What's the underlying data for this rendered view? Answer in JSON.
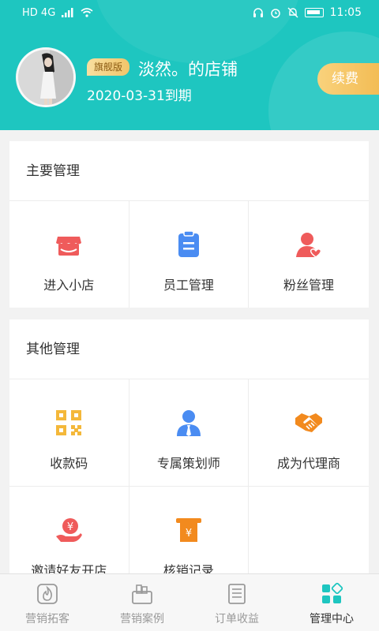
{
  "status_bar": {
    "left_text": "HD 4G",
    "time": "11:05",
    "icons": [
      "signal-icon",
      "wifi-icon",
      "headset-icon",
      "alarm-icon",
      "mute-icon",
      "battery-icon"
    ]
  },
  "header": {
    "badge": "旗舰版",
    "shop_name": "淡然。的店铺",
    "expire": "2020-03-31到期",
    "renew_label": "续费",
    "bg_color": "#1ec6c0"
  },
  "main_section": {
    "title": "主要管理",
    "items": [
      {
        "label": "进入小店",
        "icon": "shop-icon",
        "color": "#ef5b5b"
      },
      {
        "label": "员工管理",
        "icon": "clipboard-icon",
        "color": "#4a8cf2"
      },
      {
        "label": "粉丝管理",
        "icon": "fans-icon",
        "color": "#ef5b5b"
      }
    ]
  },
  "other_section": {
    "title": "其他管理",
    "items": [
      {
        "label": "收款码",
        "icon": "qr-code-icon",
        "color": "#f4b83a"
      },
      {
        "label": "专属策划师",
        "icon": "planner-icon",
        "color": "#4a8cf2"
      },
      {
        "label": "成为代理商",
        "icon": "handshake-icon",
        "color": "#f28a1e"
      },
      {
        "label": "邀请好友开店",
        "icon": "invite-money-icon",
        "color": "#ef5b5b"
      },
      {
        "label": "核销记录",
        "icon": "receipt-icon",
        "color": "#f28a1e"
      }
    ]
  },
  "tabbar": {
    "items": [
      {
        "label": "营销拓客",
        "icon": "flame-icon",
        "active": false
      },
      {
        "label": "营销案例",
        "icon": "cases-icon",
        "active": false
      },
      {
        "label": "订单收益",
        "icon": "orders-icon",
        "active": false
      },
      {
        "label": "管理中心",
        "icon": "management-icon",
        "active": true
      }
    ],
    "active_color": "#1ec6c0"
  }
}
